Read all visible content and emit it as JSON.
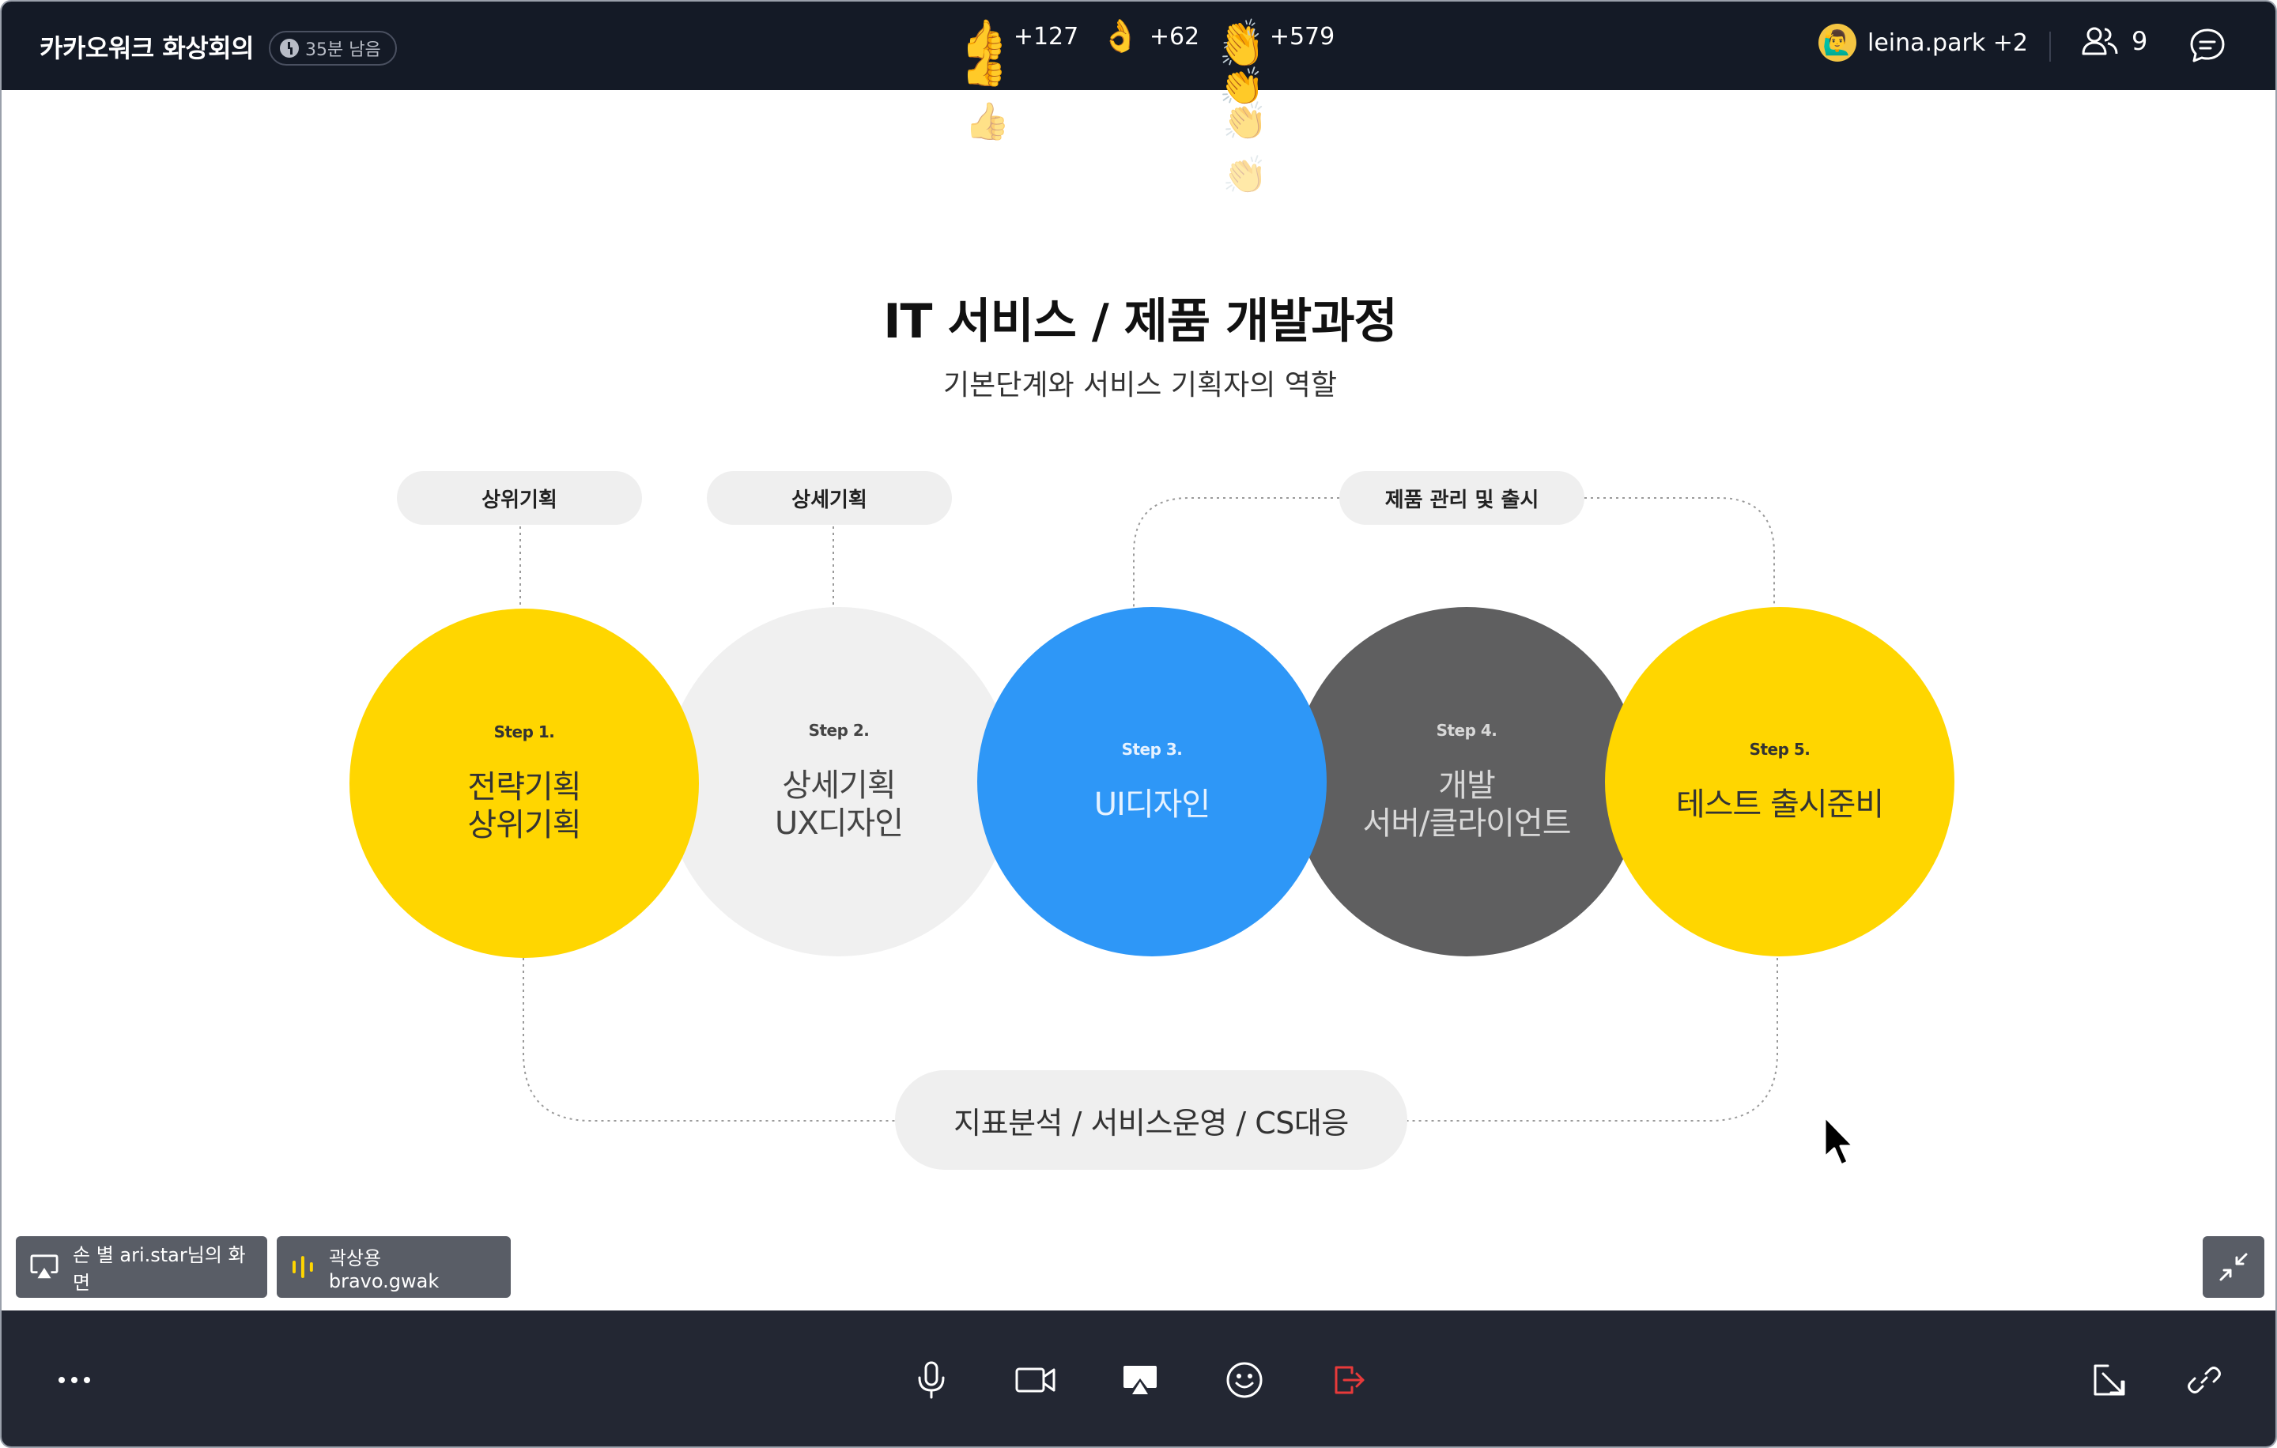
{
  "topbar": {
    "meeting_title": "카카오워크 화상회의",
    "time_remaining": "35분 남음",
    "reactions": [
      {
        "emoji": "👍",
        "count": "+127"
      },
      {
        "emoji": "👌",
        "count": "+62"
      },
      {
        "emoji": "👏",
        "count": "+579"
      }
    ],
    "floating_reactions": [
      "👍",
      "👍",
      "👍",
      "👏",
      "👏",
      "👏",
      "👏"
    ],
    "user": {
      "avatar": "🙋‍♂️",
      "name": "leina.park +2"
    },
    "participant_count": "9"
  },
  "slide": {
    "title": "IT 서비스 / 제품 개발과정",
    "subtitle": "기본단계와 서비스 기획자의 역할",
    "pills": [
      "상위기획",
      "상세기획",
      "제품 관리 및 출시"
    ],
    "steps": [
      {
        "step": "Step 1.",
        "label": "전략기획\n상위기획"
      },
      {
        "step": "Step 2.",
        "label": "상세기획\nUX디자인"
      },
      {
        "step": "Step 3.",
        "label": "UI디자인"
      },
      {
        "step": "Step 4.",
        "label": "개발\n서버/클라이언트"
      },
      {
        "step": "Step 5.",
        "label": "테스트 출시준비"
      }
    ],
    "bottom_label": "지표분석 / 서비스운영 / CS대응"
  },
  "chips": {
    "screen_share": "손 별 ari.star님의 화면",
    "speaker": "곽상용 bravo.gwak"
  },
  "colors": {
    "topbar_bg": "#141a26",
    "bottombar_bg": "#232733",
    "yellow": "#ffd600",
    "blue": "#2e97f7",
    "dark_gray": "#5f5f60",
    "light_gray": "#f0f0f0",
    "leave_red": "#e83a3a"
  },
  "icons": [
    "clock-icon",
    "people-icon",
    "chat-icon",
    "screen-share-icon",
    "audio-level-icon",
    "minimize-icon",
    "more-icon",
    "mic-icon",
    "video-icon",
    "share-screen-icon",
    "emoji-icon",
    "leave-icon",
    "popout-icon",
    "link-icon"
  ]
}
